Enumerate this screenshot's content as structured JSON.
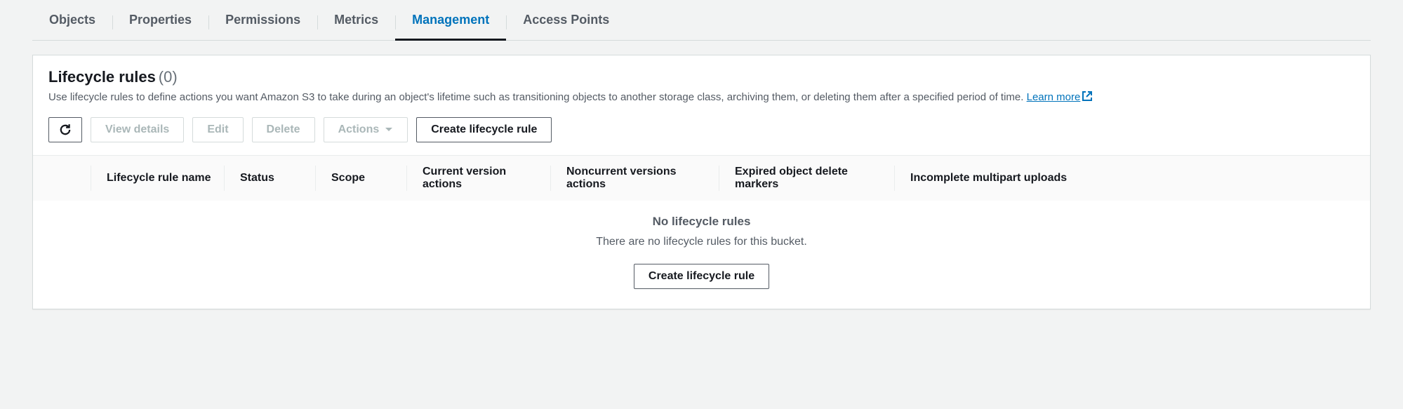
{
  "tabs": [
    {
      "label": "Objects",
      "active": false
    },
    {
      "label": "Properties",
      "active": false
    },
    {
      "label": "Permissions",
      "active": false
    },
    {
      "label": "Metrics",
      "active": false
    },
    {
      "label": "Management",
      "active": true
    },
    {
      "label": "Access Points",
      "active": false
    }
  ],
  "panel": {
    "title": "Lifecycle rules",
    "count": "(0)",
    "description": "Use lifecycle rules to define actions you want Amazon S3 to take during an object's lifetime such as transitioning objects to another storage class, archiving them, or deleting them after a specified period of time.",
    "learn_more": "Learn more"
  },
  "toolbar": {
    "view_details": "View details",
    "edit": "Edit",
    "delete": "Delete",
    "actions": "Actions",
    "create": "Create lifecycle rule"
  },
  "columns": {
    "name": "Lifecycle rule name",
    "status": "Status",
    "scope": "Scope",
    "cva": "Current version actions",
    "ncv": "Noncurrent versions actions",
    "expd": "Expired object delete markers",
    "imu": "Incomplete multipart uploads"
  },
  "empty": {
    "title": "No lifecycle rules",
    "subtitle": "There are no lifecycle rules for this bucket.",
    "button": "Create lifecycle rule"
  }
}
